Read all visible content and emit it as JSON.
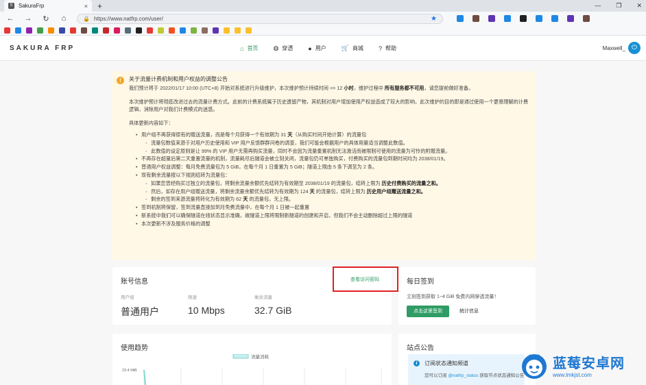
{
  "browser": {
    "tab_title": "SakuraFrp",
    "tab_favicon_letter": "S",
    "url": "https://www.natfrp.com/user/",
    "back_icon": "←",
    "forward_icon": "→",
    "reload_icon": "↻",
    "home_icon": "⌂",
    "new_tab_icon": "+",
    "close_tab_icon": "×",
    "window_controls": [
      "—",
      "❐",
      "✕"
    ],
    "bookmark_colors": [
      "#e53935",
      "#1e88e5",
      "#8e24aa",
      "#43a047",
      "#fb8c00",
      "#3949ab",
      "#e53935",
      "#6d4c41",
      "#00897b",
      "#c62828",
      "#d81b60",
      "#546e7a",
      "#212121",
      "#e53935",
      "#c0ca33",
      "#f4511e",
      "#1e88e5",
      "#7cb342",
      "#8d6e63",
      "#5e35b1",
      "#fbc02d",
      "#fbc02d",
      "#fbc02d"
    ],
    "extension_colors": [
      "#1e88e5",
      "#6d4c41",
      "#5e35b1",
      "#1e88e5",
      "#212121",
      "#1e88e5",
      "#1e88e5",
      "#5e35b1",
      "#6d4c41"
    ]
  },
  "site": {
    "logo": "SAKURA FRP",
    "nav": [
      {
        "icon": "⌂",
        "label": "首页",
        "active": true
      },
      {
        "icon": "◍",
        "label": "穿透",
        "active": false
      },
      {
        "icon": "●",
        "label": "用户",
        "active": false
      },
      {
        "icon": "🛒",
        "label": "商城",
        "active": false
      },
      {
        "icon": "?",
        "label": "帮助",
        "active": false
      }
    ],
    "username": "Maxwell_",
    "power_icon": "⏻"
  },
  "notice": {
    "title": "关于流量计费机制和用户权益的调整公告",
    "p1_prefix": "我们预计将于 2022/01/17 10:00 (UTC+8) 开始对系统进行升级维护，本次维护预计持续时间 <= 12 ",
    "p1_bold1": "小时",
    "p1_mid": "，维护过程中 ",
    "p1_bold2": "所有服务都不可用",
    "p1_suffix": "，请您提前做好准备。",
    "p2": "本次维护预计将彻底改进过去的流量计费方式。此前的计费系统属于历史遗留产物，其机制对用户增加使用产权益造成了较大的影响，此次维护的目的即是通过使用一个更易理解的计费逻辑，消除用户对我们计费模式的迷惑。",
    "p3": "具体更新内容如下：",
    "b1_prefix": "用户组不再获得原有的赠送流量，而是每个月获得一个有效期为 31 ",
    "b1_bold": "天",
    "b1_suffix": "（从购买时间开始计算）的流量包",
    "b1_sub1": "流量包数值来源于对用户历史使用和 VIP 用户反馈群群问卷的调查，我们可能会根据用户的具体用量适当调整此数值。",
    "b1_sub2": "此数值的设定原则是让 99% 的 VIP 用户无需再购买流量，同时不会因为流量重置机制无法激活而被限制可使用的流量为可怜的附赠流量。",
    "b2": "不再存在超量后第二天重置流量的机制，流量耗尽后隧道会被立刻关闭，流量包仍可单独购买，付费购买的流量包到期时间均为 2038/01/19。",
    "b3": "普通用户权益调整：每月免费流量包为 5 GiB，在每个月 1 日重置为 5 GiB；隧道上限由 5 条下调至为 2 条。",
    "b4": "现有剩余流量按以下规则结转为流量包：",
    "b4_sub1_prefix": "如果您曾经购买过独立的流量包，将剩余流量余额优先结转为有效期至 2038/01/19 的流量包，结转上限为 ",
    "b4_sub1_bold": "历史付费购买的流量之和。",
    "b4_sub2_prefix": "然后，如存在用户组赠送流量，将剩余流量余额优先结转为有效期为 124 ",
    "b4_sub2_bold1": "天",
    "b4_sub2_mid": " 的流量包，结转上限为 ",
    "b4_sub2_bold2": "历史用户组赠送流量之和。",
    "b4_sub3_prefix": "剩余的签到来源流量将转化为有效期为 62 ",
    "b4_sub3_bold": "天",
    "b4_sub3_suffix": " 的流量包，无上限。",
    "b5": "签到机制将保留，签到流量直接加到月免费流量中，在每个月 1 日被一起重置",
    "b6": "新系统中我们可以确保隧道在线状态显示准确，故隧道上限将限制新隧道的创建和开启，但我们不会主动删除超过上限的隧道",
    "b7": "本次更新不涉及服务价格的调整"
  },
  "account": {
    "title": "账号信息",
    "view_password_link": "查看访问密码",
    "stats": [
      {
        "label": "用户组",
        "value": "普通用户"
      },
      {
        "label": "限速",
        "value": "10 Mbps"
      },
      {
        "label": "剩余流量",
        "value": "32.7 GiB"
      }
    ]
  },
  "checkin": {
    "title": "每日签到",
    "desc": "立刻签到获取 1~4 GiB 免费内网穿透流量！",
    "checkin_button": "点击这里签到",
    "stats_button": "统计信息"
  },
  "trend": {
    "title": "使用趋势",
    "legend": "流量消耗",
    "y_tick": "23.4 MiB",
    "line_color": "#7fd6d0"
  },
  "site_notice": {
    "title": "站点公告",
    "sub_title": "订阅状态通知频道",
    "desc_prefix": "您可以订阅 ",
    "desc_link": "@natfrp_status",
    "desc_suffix": " 获取节点状态通知公告"
  },
  "watermark": {
    "name": "蓝莓安卓网",
    "url": "www.lmkjst.com"
  }
}
